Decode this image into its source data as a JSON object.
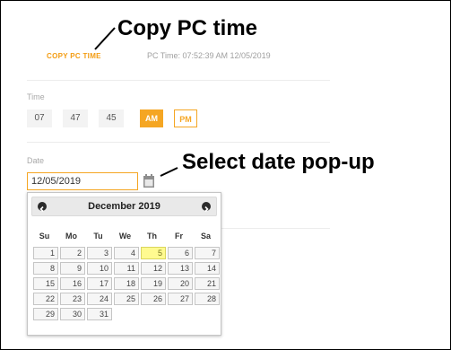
{
  "annotations": {
    "copy_pc_time": "Copy PC time",
    "select_date_popup": "Select date pop-up"
  },
  "copy_link_label": "COPY PC TIME",
  "pc_time_text": "PC Time: 07:52:39 AM 12/05/2019",
  "time": {
    "label": "Time",
    "hour": "07",
    "minute": "47",
    "second": "45",
    "am_label": "AM",
    "pm_label": "PM",
    "selected": "AM"
  },
  "date": {
    "label": "Date",
    "value": "12/05/2019",
    "icon": "calendar-icon"
  },
  "calendar": {
    "month_title": "December 2019",
    "prev_icon": "chevron-left-icon",
    "next_icon": "chevron-right-icon",
    "weekdays": [
      "Su",
      "Mo",
      "Tu",
      "We",
      "Th",
      "Fr",
      "Sa"
    ],
    "weeks": [
      [
        "1",
        "2",
        "3",
        "4",
        "5",
        "6",
        "7"
      ],
      [
        "8",
        "9",
        "10",
        "11",
        "12",
        "13",
        "14"
      ],
      [
        "15",
        "16",
        "17",
        "18",
        "19",
        "20",
        "21"
      ],
      [
        "22",
        "23",
        "24",
        "25",
        "26",
        "27",
        "28"
      ],
      [
        "29",
        "30",
        "31"
      ]
    ],
    "highlighted_day": "5",
    "colors": {
      "accent": "#f5a623",
      "today_bg": "#fffa90"
    }
  }
}
